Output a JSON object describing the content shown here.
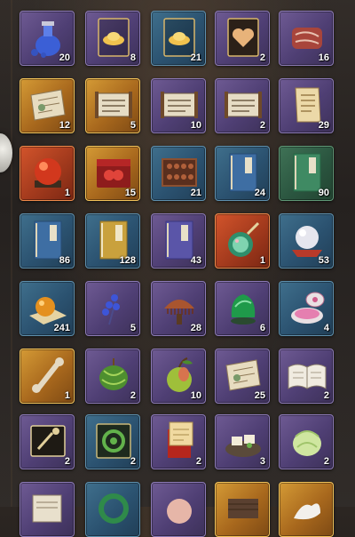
{
  "inventory": {
    "rows": [
      [
        {
          "icon": "potion-bottle-icon",
          "quality": "purple",
          "count": "20"
        },
        {
          "icon": "gold-ingot-card-icon",
          "quality": "purple",
          "count": "8"
        },
        {
          "icon": "gold-ingot-card-icon",
          "quality": "blue",
          "count": "21"
        },
        {
          "icon": "heart-card-icon",
          "quality": "purple",
          "count": "2"
        },
        {
          "icon": "meat-steak-icon",
          "quality": "purple",
          "count": "16"
        }
      ],
      [
        {
          "icon": "scroll-map-icon",
          "quality": "gold",
          "count": "12"
        },
        {
          "icon": "painting-scroll-icon",
          "quality": "gold",
          "count": "5"
        },
        {
          "icon": "painting-scroll-icon",
          "quality": "purple",
          "count": "10"
        },
        {
          "icon": "painting-scroll-icon",
          "quality": "purple",
          "count": "2"
        },
        {
          "icon": "letter-scroll-icon",
          "quality": "purple",
          "count": "29"
        }
      ],
      [
        {
          "icon": "red-orb-icon",
          "quality": "red",
          "count": "1"
        },
        {
          "icon": "red-box-orbs-icon",
          "quality": "gold",
          "count": "15"
        },
        {
          "icon": "abacus-icon",
          "quality": "blue",
          "count": "21"
        },
        {
          "icon": "blue-book-icon",
          "quality": "blue",
          "count": "24"
        },
        {
          "icon": "green-book-icon",
          "quality": "green",
          "count": "90"
        }
      ],
      [
        {
          "icon": "blue-book-icon",
          "quality": "blue",
          "count": "86"
        },
        {
          "icon": "yellow-book-icon",
          "quality": "blue",
          "count": "128"
        },
        {
          "icon": "purple-book-icon",
          "quality": "purple",
          "count": "43"
        },
        {
          "icon": "jade-vase-icon",
          "quality": "red",
          "count": "1"
        },
        {
          "icon": "pearl-icon",
          "quality": "blue",
          "count": "53"
        }
      ],
      [
        {
          "icon": "orange-orb-icon",
          "quality": "blue",
          "count": "241"
        },
        {
          "icon": "blue-flower-icon",
          "quality": "purple",
          "count": "5"
        },
        {
          "icon": "wooden-comb-icon",
          "quality": "purple",
          "count": "28"
        },
        {
          "icon": "green-jade-icon",
          "quality": "purple",
          "count": "6"
        },
        {
          "icon": "rouge-box-icon",
          "quality": "blue",
          "count": "4"
        }
      ],
      [
        {
          "icon": "bone-icon",
          "quality": "gold",
          "count": "1"
        },
        {
          "icon": "melon-icon",
          "quality": "purple",
          "count": "2"
        },
        {
          "icon": "pear-fruit-icon",
          "quality": "purple",
          "count": "10"
        },
        {
          "icon": "map-scroll-icon",
          "quality": "purple",
          "count": "25"
        },
        {
          "icon": "open-book-icon",
          "quality": "purple",
          "count": "2"
        }
      ],
      [
        {
          "icon": "ticket-card-icon",
          "quality": "purple",
          "count": "2"
        },
        {
          "icon": "swirl-card-icon",
          "quality": "blue",
          "count": "2"
        },
        {
          "icon": "red-envelope-icon",
          "quality": "purple",
          "count": "2"
        },
        {
          "icon": "tofu-plate-icon",
          "quality": "purple",
          "count": "3"
        },
        {
          "icon": "cabbage-icon",
          "quality": "purple",
          "count": "2"
        }
      ],
      [
        {
          "icon": "paper-stack-icon",
          "quality": "purple",
          "count": ""
        },
        {
          "icon": "green-wreath-icon",
          "quality": "blue",
          "count": ""
        },
        {
          "icon": "pink-sphere-icon",
          "quality": "purple",
          "count": ""
        },
        {
          "icon": "wood-block-icon",
          "quality": "gold",
          "count": ""
        },
        {
          "icon": "white-swan-icon",
          "quality": "gold",
          "count": ""
        }
      ]
    ]
  }
}
